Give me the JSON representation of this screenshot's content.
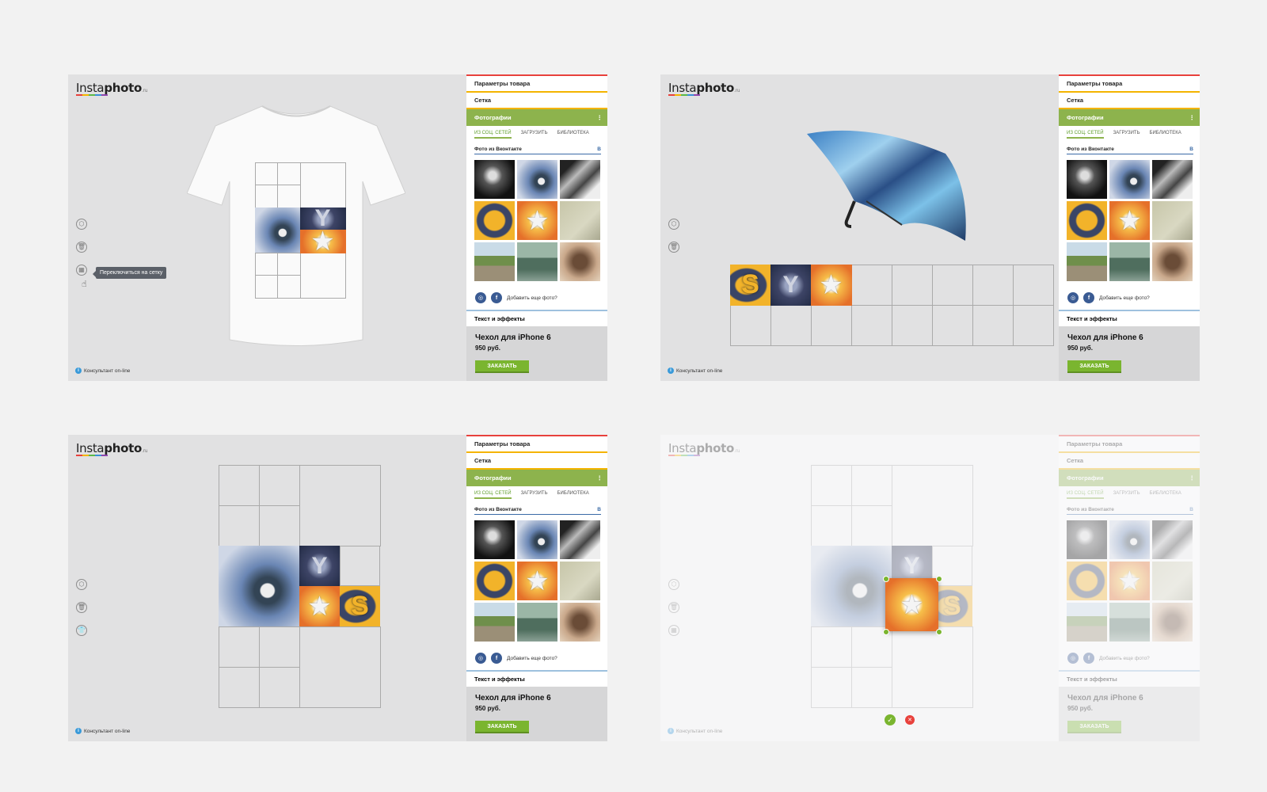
{
  "logo": {
    "main": "Insta",
    "bold": "photo",
    "suffix": ".ru"
  },
  "sidebar": {
    "params": "Параметры товара",
    "grid": "Сетка",
    "photos": "Фотографии",
    "photos_icon": "⋮",
    "tabs": [
      "ИЗ СОЦ. СЕТЕЙ",
      "ЗАГРУЗИТЬ",
      "БИБЛИОТЕКА"
    ],
    "source_title": "Фото из Вконтакте",
    "source_icon": "B",
    "add_more": "Добавить еще фото?",
    "social_instagram": "◎",
    "social_facebook": "f",
    "text_effects": "Текст и эффекты",
    "product_name": "Чехол для iPhone 6",
    "price": "950 руб.",
    "order_button": "ЗАКАЗАТЬ"
  },
  "consultant": "Консультант on-line",
  "consultant_icon": "i",
  "tooltip": "Переключиться на сетку",
  "tools": {
    "cube": "⬡",
    "trash": "🗑",
    "grid": "▦",
    "shirt": "👕"
  },
  "confirm": {
    "ok": "✓",
    "cancel": "✕"
  },
  "colors": {
    "accent_green": "#8db34d",
    "order_green": "#7ab52f",
    "vk_blue": "#3a6aa6"
  }
}
